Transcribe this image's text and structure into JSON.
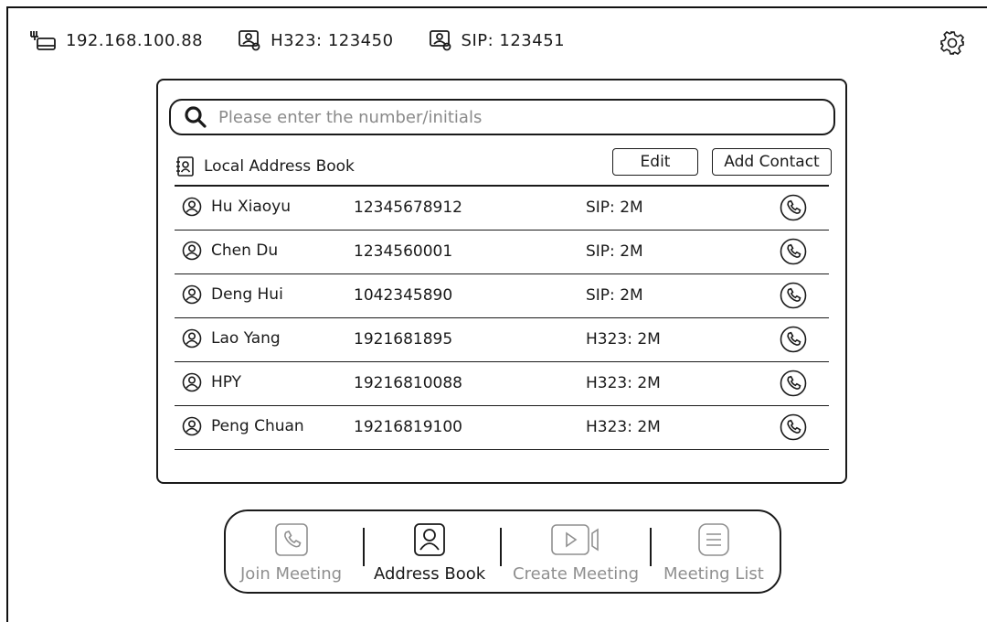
{
  "status_bar": {
    "ip_address": "192.168.100.88",
    "h323": "H323: 123450",
    "sip": "SIP: 123451",
    "icons": [
      "network-icon",
      "contact-card-icon",
      "contact-card-icon",
      "gear-icon"
    ]
  },
  "search": {
    "placeholder": "Please enter the number/initials"
  },
  "address_book": {
    "title": "Local Address Book",
    "edit_label": "Edit",
    "add_contact_label": "Add Contact",
    "contacts": [
      {
        "name": "Hu Xiaoyu",
        "number": "12345678912",
        "protocol": "SIP: 2M"
      },
      {
        "name": "Chen Du",
        "number": "1234560001",
        "protocol": "SIP: 2M"
      },
      {
        "name": "Deng Hui",
        "number": "1042345890",
        "protocol": "SIP: 2M"
      },
      {
        "name": "Lao Yang",
        "number": "1921681895",
        "protocol": "H323: 2M"
      },
      {
        "name": "HPY",
        "number": "19216810088",
        "protocol": "H323: 2M"
      },
      {
        "name": "Peng Chuan",
        "number": "19216819100",
        "protocol": "H323: 2M"
      }
    ]
  },
  "nav": {
    "items": [
      {
        "label": "Join Meeting",
        "icon": "phone-icon",
        "active": false
      },
      {
        "label": "Address Book",
        "icon": "contact-icon",
        "active": true
      },
      {
        "label": "Create Meeting",
        "icon": "video-icon",
        "active": false
      },
      {
        "label": "Meeting List",
        "icon": "list-icon",
        "active": false
      }
    ]
  },
  "colors": {
    "foreground": "#1a1a1a",
    "inactive": "#8f8f8f",
    "background": "#ffffff"
  }
}
